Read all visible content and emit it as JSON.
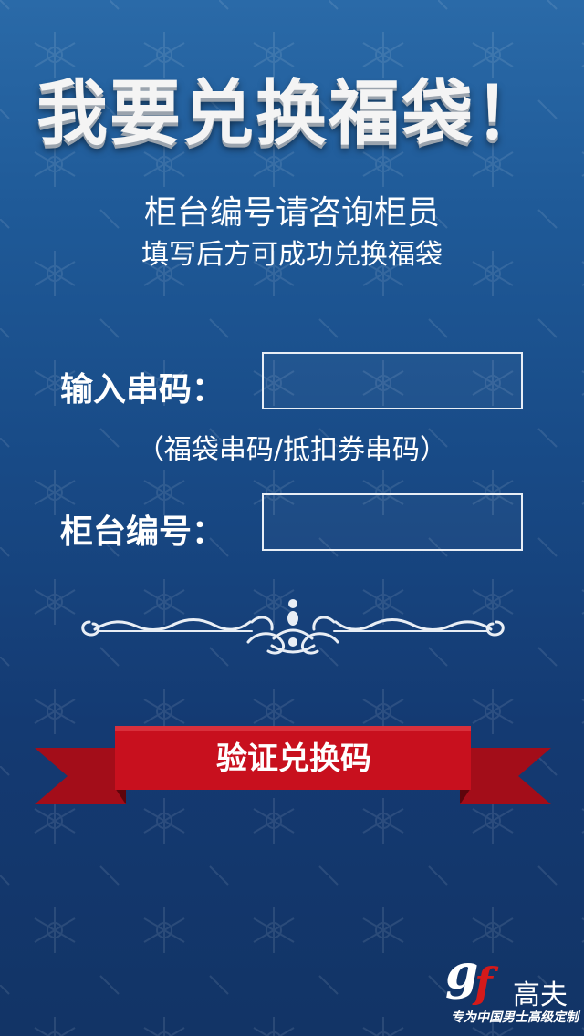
{
  "header": {
    "title": "我要兑换福袋！",
    "line1": "柜台编号请咨询柜员",
    "line2": "填写后方可成功兑换福袋"
  },
  "form": {
    "serial_label": "输入串码：",
    "serial_value": "",
    "serial_hint": "（福袋串码/抵扣券串码）",
    "counter_label": "柜台编号：",
    "counter_value": ""
  },
  "ornament_icon": "scroll-ornament-icon",
  "submit": {
    "label": "验证兑换码",
    "ribbon_color": "#c8101e"
  },
  "brand": {
    "logo_text": "gf",
    "name": "高夫",
    "tagline": "专为中国男士高级定制"
  },
  "colors": {
    "background_top": "#2a6aa8",
    "background_bottom": "#123466",
    "ribbon": "#c8101e",
    "ribbon_dark": "#8c0a14",
    "text": "#ffffff"
  }
}
